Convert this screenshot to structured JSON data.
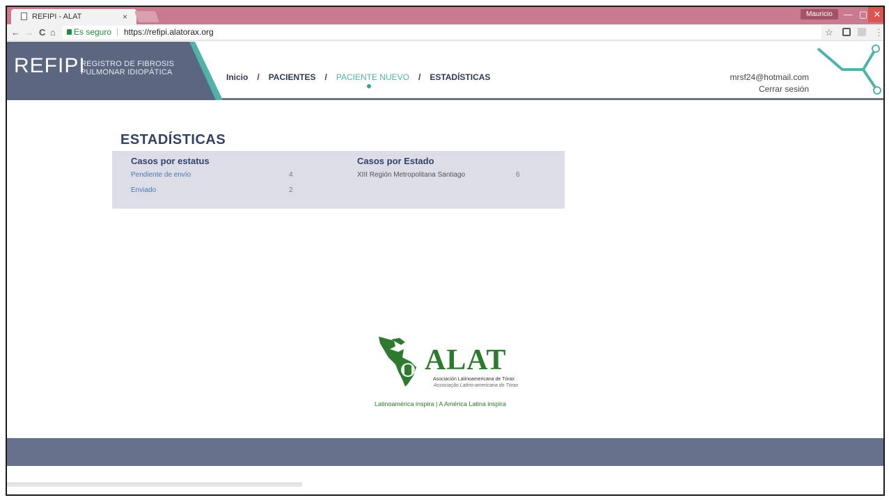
{
  "browser": {
    "tab_title": "REFIPI - ALAT",
    "tab_close": "×",
    "window_user": "Mauricio",
    "minimize": "—",
    "maximize": "▢",
    "close": "✕",
    "secure_label": "Es seguro",
    "url": "https://refipi.alatorax.org",
    "nav_icons": {
      "back": "←",
      "forward": "→",
      "reload": "C",
      "home": "⌂",
      "star": "☆"
    }
  },
  "header": {
    "logo": "REFIPI",
    "logo_sub_line1": "REGISTRO DE FIBROSIS",
    "logo_sub_line2": "PULMONAR IDIOPÁTICA",
    "nav": [
      {
        "label": "Inicio"
      },
      {
        "label": "PACIENTES"
      },
      {
        "label": "PACIENTE NUEVO"
      },
      {
        "label": "ESTADÍSTICAS"
      }
    ],
    "separator": "/",
    "user_email": "mrsf24@hotmail.com",
    "logout": "Cerrar sesión"
  },
  "page": {
    "title": "ESTADÍSTICAS",
    "status_section": {
      "heading": "Casos por estatus",
      "rows": [
        {
          "label": "Pendiente de envío",
          "value": "4"
        },
        {
          "label": "Enviado",
          "value": "2"
        }
      ]
    },
    "state_section": {
      "heading": "Casos por Estado",
      "rows": [
        {
          "label": "XIII Región Metropolitana Santiago",
          "value": "6"
        }
      ]
    }
  },
  "footer_logo": {
    "name": "ALAT",
    "es": "Asociación Latinoamericana de Tórax",
    "pt": "Associação Latino-americana do Tórax",
    "tagline": "Latinoamérica inspira | A América Latina inspira"
  },
  "colors": {
    "accent": "#4fb3a9",
    "header_logo_bg": "#5b6780",
    "title": "#34426a",
    "panel_bg": "#dcdde6",
    "footer": "#66728c",
    "link": "#4a7ab5",
    "alat_green": "#2d7a2f"
  }
}
